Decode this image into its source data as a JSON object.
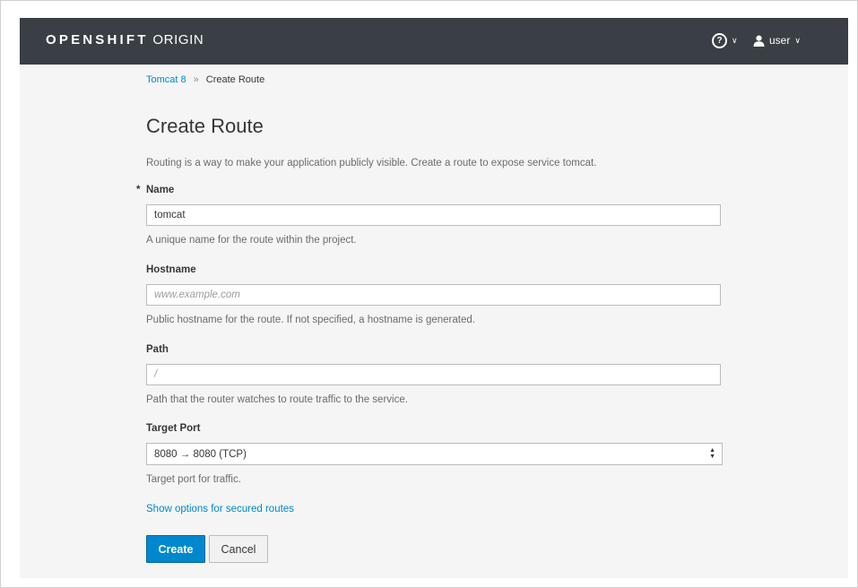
{
  "header": {
    "brand_bold": "OPENSHIFT",
    "brand_light": " ORIGIN",
    "help_icon": "help-circle-icon",
    "user_icon": "user-icon",
    "user_label": "user",
    "colors": {
      "topbar": "#393f44",
      "accent": "#0088ce"
    }
  },
  "breadcrumb": {
    "parent": "Tomcat 8",
    "separator": "»",
    "current": "Create Route"
  },
  "page": {
    "title": "Create Route",
    "intro": "Routing is a way to make your application publicly visible. Create a route to expose service tomcat."
  },
  "form": {
    "name": {
      "required_marker": "*",
      "label": "Name",
      "value": "tomcat",
      "help": "A unique name for the route within the project."
    },
    "hostname": {
      "label": "Hostname",
      "placeholder": "www.example.com",
      "help": "Public hostname for the route. If not specified, a hostname is generated."
    },
    "path": {
      "label": "Path",
      "placeholder": "/",
      "help": "Path that the router watches to route traffic to the service."
    },
    "target_port": {
      "label": "Target Port",
      "selected": "8080 → 8080 (TCP)",
      "help": "Target port for traffic."
    },
    "secure_link": "Show options for secured routes",
    "create_label": "Create",
    "cancel_label": "Cancel"
  }
}
